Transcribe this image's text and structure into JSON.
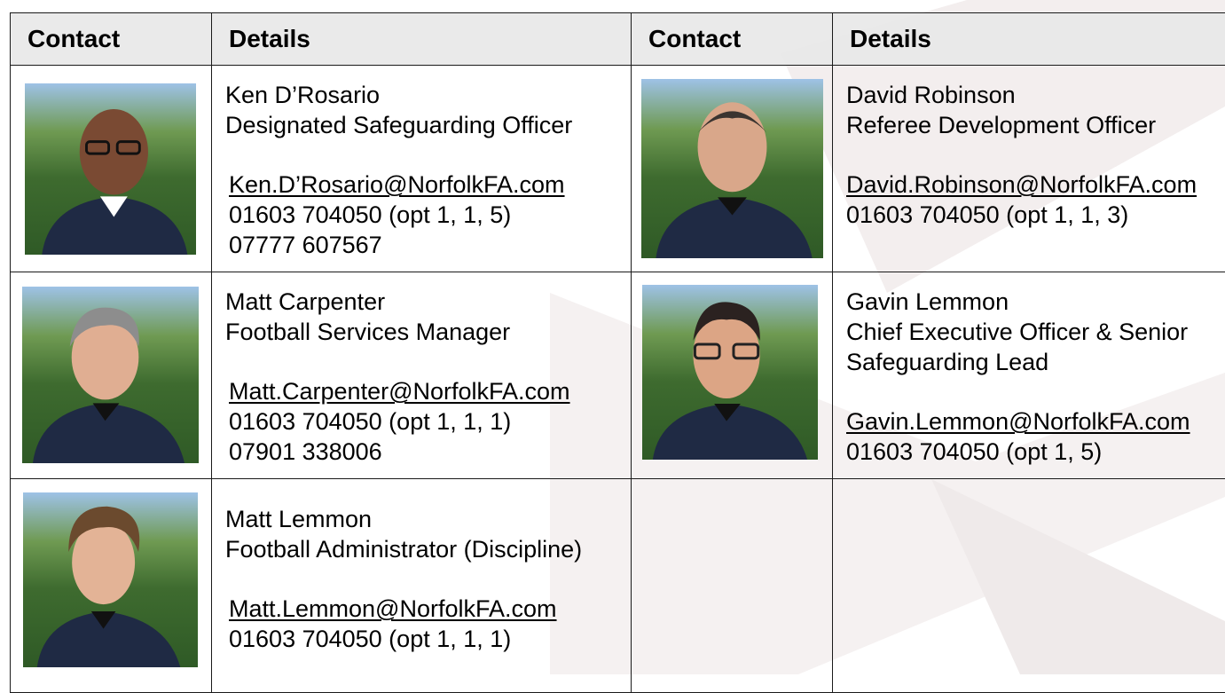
{
  "headers": [
    "Contact",
    "Details",
    "Contact",
    "Details"
  ],
  "contacts": [
    {
      "name": "Ken D’Rosario",
      "role_lines": [
        "Designated Safeguarding Officer"
      ],
      "email": "Ken.D’Rosario@NorfolkFA.com",
      "phones": [
        "01603 704050 (opt 1, 1, 5)",
        "07777 607567"
      ]
    },
    {
      "name": "David Robinson",
      "role_lines": [
        "Referee Development Officer"
      ],
      "email": "David.Robinson@NorfolkFA.com",
      "phones": [
        "01603 704050 (opt 1, 1, 3)"
      ]
    },
    {
      "name": "Matt Carpenter",
      "role_lines": [
        "Football Services Manager"
      ],
      "email": "Matt.Carpenter@NorfolkFA.com",
      "phones": [
        "01603 704050 (opt 1, 1, 1)",
        "07901 338006"
      ]
    },
    {
      "name": "Gavin Lemmon",
      "role_lines": [
        "Chief Executive Officer & Senior",
        "Safeguarding Lead"
      ],
      "email": "Gavin.Lemmon@NorfolkFA.com",
      "phones": [
        "01603 704050 (opt 1, 5)"
      ]
    },
    {
      "name": "Matt Lemmon",
      "role_lines": [
        "Football Administrator (Discipline)"
      ],
      "email": "Matt.Lemmon@NorfolkFA.com",
      "phones": [
        "01603 704050 (opt 1, 1, 1)"
      ]
    }
  ],
  "colors": {
    "header_bg": "#e8e8e8",
    "border": "#1a1a1a",
    "shirt": "#1f2a44"
  }
}
